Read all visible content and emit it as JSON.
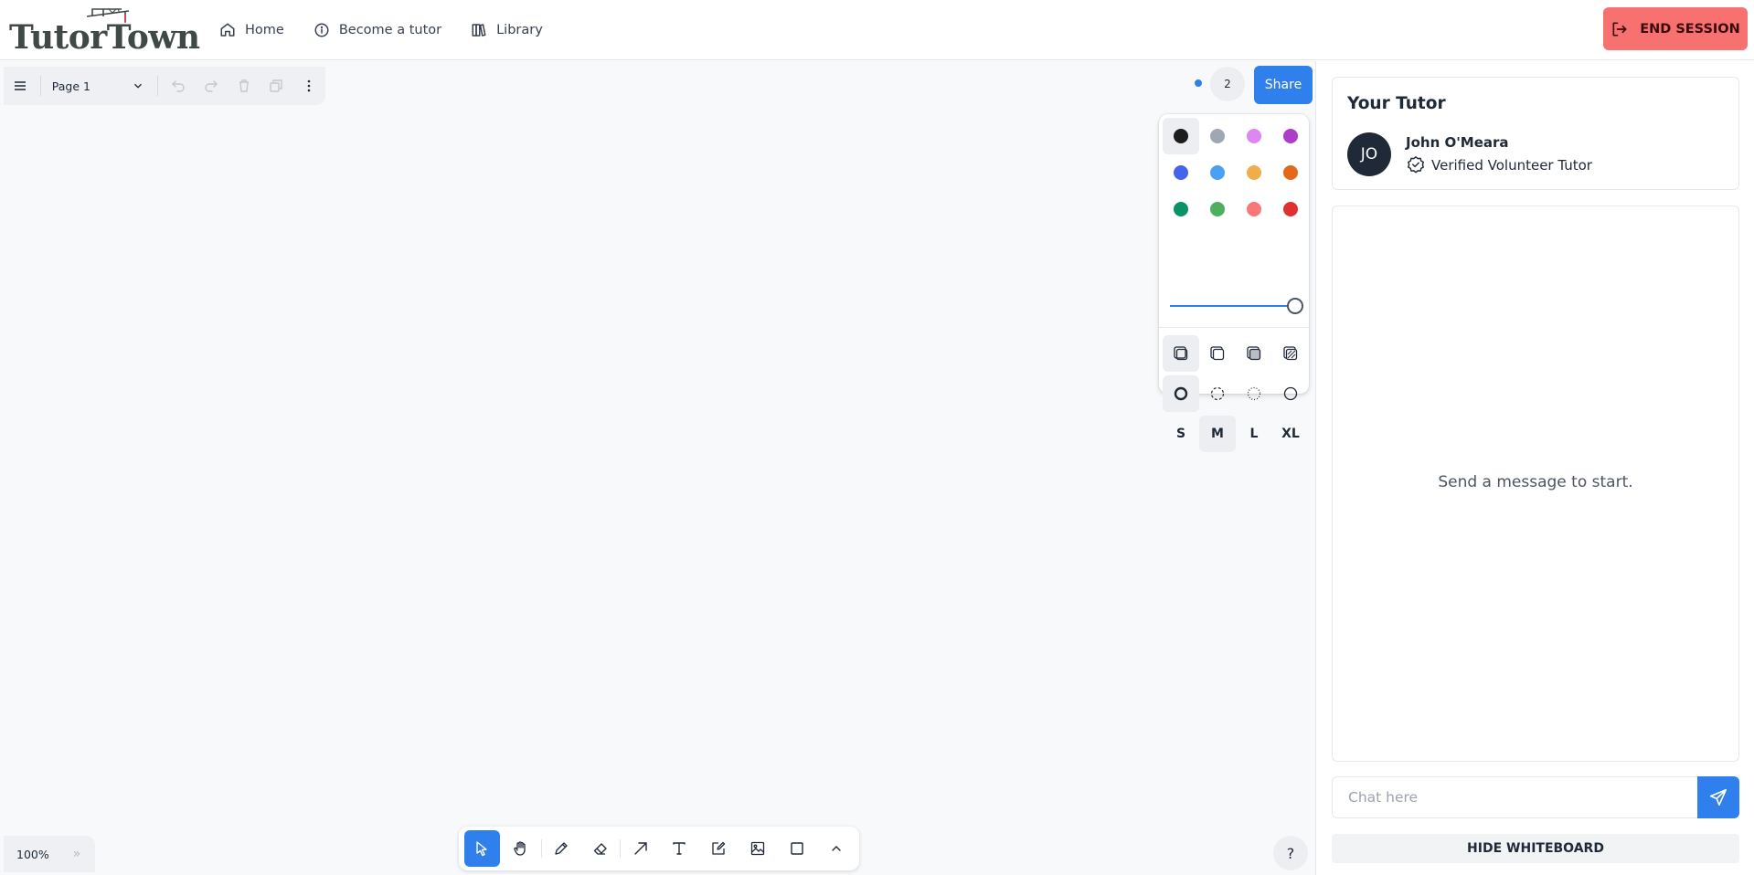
{
  "brand": {
    "logo_text": "TutorTown",
    "logo_color": "#3f4a46"
  },
  "nav": {
    "items": [
      {
        "label": "Home",
        "icon": "home-icon"
      },
      {
        "label": "Become a tutor",
        "icon": "info-icon"
      },
      {
        "label": "Library",
        "icon": "library-icon"
      }
    ]
  },
  "end_session": {
    "label": "END SESSION",
    "icon": "exit-icon",
    "color": "#f87171"
  },
  "whiteboard": {
    "page_select": {
      "value": "Page 1"
    },
    "presence_count": "2",
    "share_label": "Share",
    "accent": "#2f80ed",
    "zoom": "100%",
    "help_label": "?",
    "colors": [
      "#1d1d1d",
      "#9fa8b2",
      "#e085f4",
      "#ae3ec9",
      "#4465e9",
      "#4ba1f1",
      "#f1ac4b",
      "#e16919",
      "#099268",
      "#4cb05e",
      "#f87777",
      "#e03131"
    ],
    "selected_color": "#1d1d1d",
    "opacity": 1,
    "fill_styles": [
      "fill-none-icon",
      "fill-semi-icon",
      "fill-solid-icon",
      "fill-pattern-icon"
    ],
    "dash_styles": [
      "dash-draw-icon",
      "dash-dashed-icon",
      "dash-dotted-icon",
      "dash-solid-icon"
    ],
    "sizes": [
      "S",
      "M",
      "L",
      "XL"
    ],
    "selected_size": "M",
    "tools": [
      "select-icon",
      "hand-icon",
      "draw-icon",
      "eraser-icon",
      "arrow-icon",
      "text-icon",
      "note-icon",
      "image-icon",
      "rectangle-icon",
      "more-tools-icon"
    ],
    "active_tool": "select-icon"
  },
  "tutor": {
    "heading": "Your Tutor",
    "initials": "JO",
    "name": "John O'Meara",
    "role": "Verified Volunteer Tutor"
  },
  "chat": {
    "empty_text": "Send a message to start.",
    "placeholder": "Chat here",
    "value": ""
  },
  "hide_whiteboard": "HIDE WHITEBOARD"
}
